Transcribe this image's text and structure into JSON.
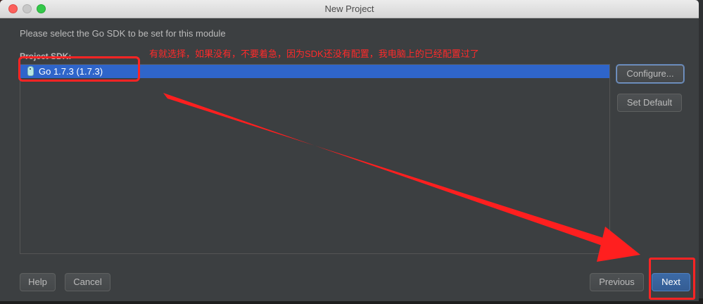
{
  "window": {
    "title": "New Project"
  },
  "dialog": {
    "prompt": "Please select the Go SDK to be set for this module",
    "sdk_label": "Project SDK:",
    "annotation": "有就选择，如果没有，不要着急，因为SDK还没有配置，我电脑上的已经配置过了",
    "sdk_items": [
      {
        "label": "Go 1.7.3 (1.7.3)",
        "selected": true
      }
    ]
  },
  "side_buttons": {
    "configure": "Configure...",
    "set_default": "Set Default"
  },
  "footer": {
    "help": "Help",
    "cancel": "Cancel",
    "previous": "Previous",
    "next": "Next"
  },
  "colors": {
    "selection": "#2f65ca",
    "annotation": "#ff2a2a",
    "panel": "#3c3f41"
  }
}
